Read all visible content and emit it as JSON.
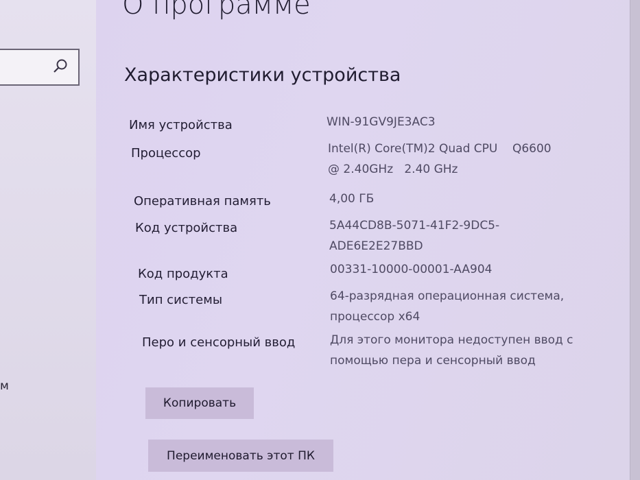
{
  "page": {
    "title": "О программе",
    "section_title": "Характеристики устройства",
    "left_fragment": "м"
  },
  "specs": [
    {
      "label": "Имя устройства",
      "value_lines": [
        "WIN-91GV9JE3AC3"
      ]
    },
    {
      "label": "Процессор",
      "value_lines": [
        "Intel(R) Core(TM)2 Quad CPU    Q6600",
        "@ 2.40GHz   2.40 GHz"
      ]
    },
    {
      "label": "Оперативная память",
      "value_lines": [
        "4,00 ГБ"
      ]
    },
    {
      "label": "Код устройства",
      "value_lines": [
        "5A44CD8B-5071-41F2-9DC5-",
        "ADE6E2E27BBD"
      ]
    },
    {
      "label": "Код продукта",
      "value_lines": [
        "00331-10000-00001-AA904"
      ]
    },
    {
      "label": "Тип системы",
      "value_lines": [
        "64-разрядная операционная система,",
        "процессор x64"
      ]
    },
    {
      "label": "Перо и сенсорный ввод",
      "value_lines": [
        "Для этого монитора недоступен ввод с",
        "помощью пера и сенсорный ввод"
      ]
    }
  ],
  "buttons": {
    "copy_label": "Копировать",
    "rename_label": "Переименовать этот ПК"
  },
  "icons": {
    "search": "search-icon"
  }
}
